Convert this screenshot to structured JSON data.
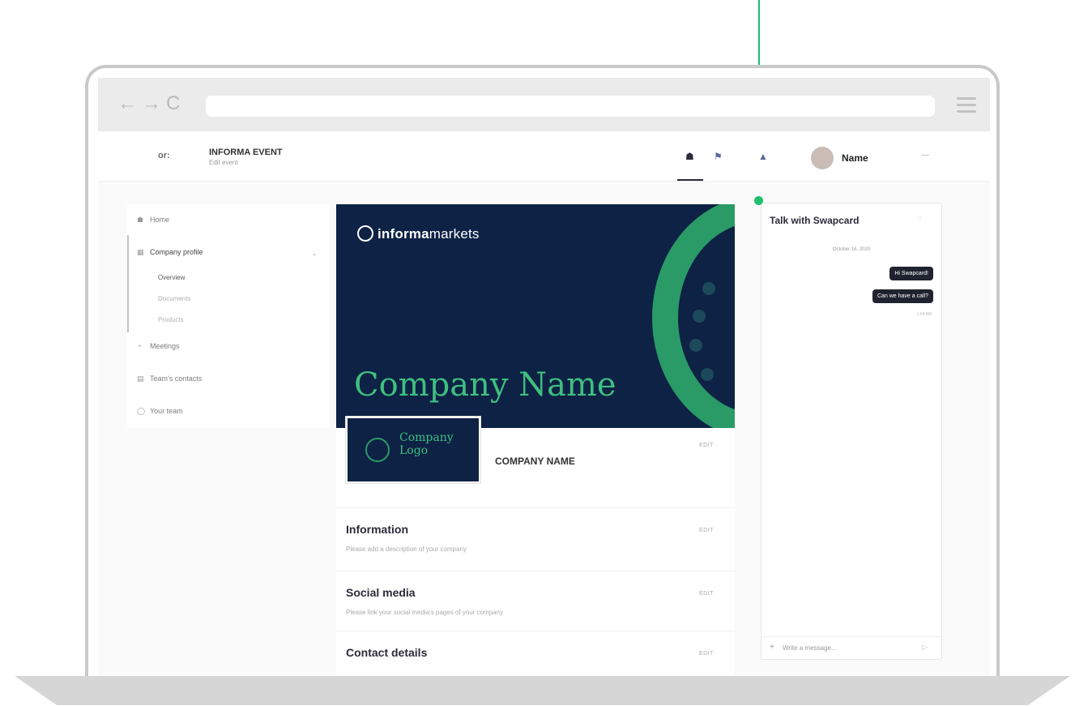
{
  "browser": {
    "back_glyph": "←",
    "forward_glyph": "→",
    "reload_glyph": "C",
    "icons": [
      "arrow-back-icon",
      "arrow-forward-icon",
      "reload-icon",
      "hamburger-menu-icon"
    ]
  },
  "header": {
    "event_logo": "or:",
    "event_name": "INFORMA EVENT",
    "event_sub": "Edit event",
    "user_name": "Name",
    "icons": [
      "home-icon",
      "chat-icon",
      "bell-icon",
      "avatar",
      "chevron-down-icon"
    ]
  },
  "sidebar": {
    "items": [
      {
        "label": "Home",
        "icon": "home-icon"
      },
      {
        "label": "Company profile",
        "icon": "building-icon"
      },
      {
        "label": "Meetings",
        "icon": "calendar-icon"
      },
      {
        "label": "Team's contacts",
        "icon": "contacts-icon"
      },
      {
        "label": "Your team",
        "icon": "team-icon"
      }
    ],
    "sub_items": [
      "Overview",
      "Documents",
      "Products"
    ],
    "active_sub": "Overview"
  },
  "main": {
    "brand_bold": "informa",
    "brand_light": "markets",
    "banner_title": "Company Name",
    "logo_text_1": "Company",
    "logo_text_2": "Logo",
    "company_name": "COMPANY NAME",
    "edit_label": "EDIT",
    "sections": [
      {
        "title": "Information",
        "desc": "Please add a description of your company"
      },
      {
        "title": "Social media",
        "desc": "Please link your social media's pages of your company"
      },
      {
        "title": "Contact details",
        "desc": ""
      }
    ]
  },
  "chat": {
    "title": "Talk with Swapcard",
    "date": "October 16, 2020",
    "messages": [
      "Hi Swapcard!",
      "Can we have a call?"
    ],
    "time": "1:04 AM",
    "placeholder": "Write a message..."
  },
  "colors": {
    "accent": "#1fbf6e",
    "banner_bg": "#0d2245",
    "brand_green": "#3fbf7f"
  }
}
